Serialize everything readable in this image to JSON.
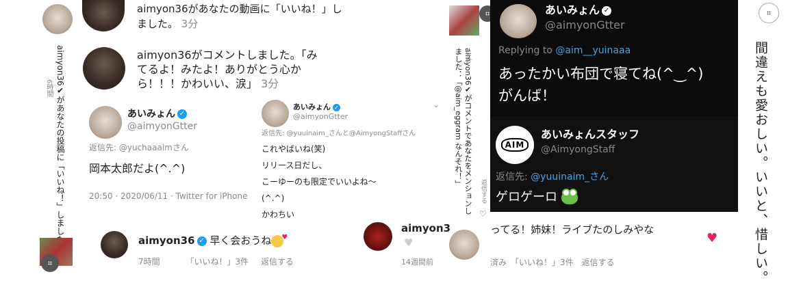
{
  "left_strip": {
    "notification": "aimyon36✔があなたの投稿に「いいね！」しました。",
    "time": "6時間"
  },
  "top_notifications": [
    {
      "text": "aimyon36があなたの動画に「いいね！」しました。",
      "time": "3分"
    },
    {
      "line1": "aimyon36がコメントしました。「み",
      "line2": "てるよ！みたよ！ありがとう心か",
      "line3": "ら！！！かわいい、涙」",
      "time": "3分"
    }
  ],
  "tweet_a": {
    "name": "あいみょん",
    "handle": "@aimyonGtter",
    "reply_to": "返信先: @yuchaaaimさん",
    "body": "岡本太郎だよ(^.^)",
    "meta": "20:50 · 2020/06/11 · Twitter for iPhone"
  },
  "tweet_b": {
    "name": "あいみょん",
    "handle": "@aimyonGtter",
    "reply_to": "返信先: @yuuinaim_さんと@AimyongStaffさん",
    "lines": [
      "これやばいね(笑)",
      "リリース日だし、",
      "こーゆーのも限定でいいよね〜",
      "(^.^)",
      "かわちい"
    ]
  },
  "comment_row": {
    "user": "aimyon36",
    "text": "早く会おうね",
    "time": "7時間",
    "likes": "「いいね！」3件",
    "reply": "返信する",
    "user_right": "aimyon3",
    "time_right": "14週間前"
  },
  "middle_strip": {
    "line1": "aimyon36✔がコメントであなたをメンションしました：「@aim_eggram なんそれ！」",
    "time": "14分",
    "reply": "返信する"
  },
  "dark_tweet": {
    "name": "あいみょん",
    "handle": "@aimyonGtter",
    "replying_prefix": "Replying to",
    "replying_handle": "@aim__yuinaaa",
    "body1": "あったかい布団で寝てね(^‿^)",
    "body2": "がんば！"
  },
  "staff_tweet": {
    "logo": "AIM",
    "name": "あいみょんスタッフ",
    "handle": "@AimyongStaff",
    "reply_to_prefix": "返信先:",
    "reply_to_handle": "@yuuinaim_さん",
    "body": "ゲロゲーロ"
  },
  "bottom_comment": {
    "text": "ってる！姉妹！ライブたのしみやな",
    "footer": "済み　「いいね！」3件　返信する"
  },
  "right_strip": {
    "text": "間違えも愛おしい。いいと、惜しい。"
  },
  "colors": {
    "link": "#4aa3e0",
    "dark_bg": "#0b0b0b",
    "heart": "#e0245e"
  }
}
